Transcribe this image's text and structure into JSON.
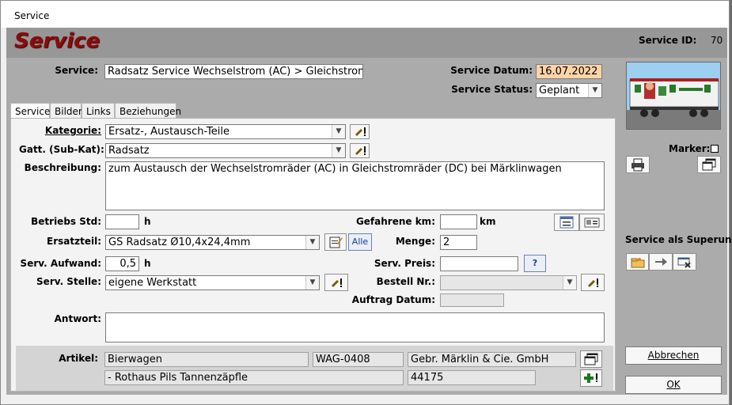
{
  "window": {
    "title": "Service"
  },
  "header": {
    "title": "Service",
    "service_id_label": "Service ID:",
    "service_id_value": "70"
  },
  "form": {
    "service_label": "Service:",
    "service_value": "Radsatz Service Wechselstrom (AC) > Gleichstrom (",
    "datum_label": "Service Datum:",
    "datum_value": "16.07.2022",
    "status_label": "Service Status:",
    "status_value": "Geplant"
  },
  "tabs": [
    {
      "label": "Service"
    },
    {
      "label": "Bilder"
    },
    {
      "label": "Links"
    },
    {
      "label": "Beziehungen"
    }
  ],
  "panel": {
    "kategorie_label": "Kategorie:",
    "kategorie_value": "Ersatz-, Austausch-Teile",
    "gatt_label": "Gatt. (Sub-Kat):",
    "gatt_value": "Radsatz",
    "beschreibung_label": "Beschreibung:",
    "beschreibung_value": "zum Austausch der Wechselstromräder (AC) in Gleichstromräder (DC) bei Märklinwagen",
    "betriebs_label": "Betriebs Std:",
    "betriebs_value": "",
    "h_unit": "h",
    "gefahrene_label": "Gefahrene km:",
    "gefahrene_value": "",
    "km_unit": "km",
    "ersatzteil_label": "Ersatzteil:",
    "ersatzteil_value": "GS Radsatz Ø10,4x24,4mm",
    "alle_label": "Alle",
    "menge_label": "Menge:",
    "menge_value": "2",
    "aufwand_label": "Serv. Aufwand:",
    "aufwand_value": "0,5",
    "preis_label": "Serv. Preis:",
    "preis_value": "",
    "help_label": "?",
    "stelle_label": "Serv. Stelle:",
    "stelle_value": "eigene Werkstatt",
    "bestell_label": "Bestell Nr.:",
    "bestell_value": "",
    "auftrag_label": "Auftrag Datum:",
    "auftrag_value": "",
    "antwort_label": "Antwort:",
    "antwort_value": ""
  },
  "artikel": {
    "label": "Artikel:",
    "name": "Bierwagen",
    "number": "WAG-0408",
    "maker": "Gebr. Märklin & Cie. GmbH",
    "subtitle": "- Rothaus Pils Tannenzäpfle",
    "code": "44175"
  },
  "side": {
    "marker_label": "Marker:",
    "superung_label": "Service als Superung",
    "cancel_label": "Abbrechen",
    "ok_label": "OK"
  },
  "colors": {
    "header_title": "#8b0b0b",
    "date_bg": "#fcd4a8"
  }
}
